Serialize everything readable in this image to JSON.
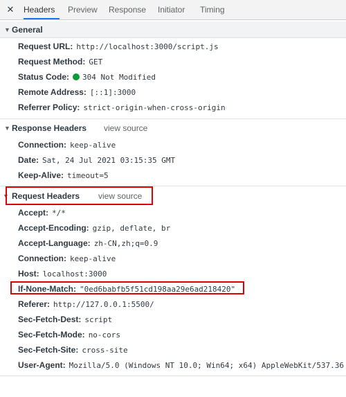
{
  "tabs": {
    "close": "✕",
    "items": [
      "Headers",
      "Preview",
      "Response",
      "Initiator",
      "Timing"
    ]
  },
  "general": {
    "title": "General",
    "request_url": {
      "key": "Request URL:",
      "value": "http://localhost:3000/script.js"
    },
    "request_method": {
      "key": "Request Method:",
      "value": "GET"
    },
    "status_code": {
      "key": "Status Code:",
      "value": "304 Not Modified",
      "status_color": "#0a9a3a"
    },
    "remote_address": {
      "key": "Remote Address:",
      "value": "[::1]:3000"
    },
    "referrer_policy": {
      "key": "Referrer Policy:",
      "value": "strict-origin-when-cross-origin"
    }
  },
  "response_headers": {
    "title": "Response Headers",
    "view_source": "view source",
    "rows": [
      {
        "key": "Connection:",
        "value": "keep-alive"
      },
      {
        "key": "Date:",
        "value": "Sat, 24 Jul 2021 03:15:35 GMT"
      },
      {
        "key": "Keep-Alive:",
        "value": "timeout=5"
      }
    ]
  },
  "request_headers": {
    "title": "Request Headers",
    "view_source": "view source",
    "rows": [
      {
        "key": "Accept:",
        "value": "*/*"
      },
      {
        "key": "Accept-Encoding:",
        "value": "gzip, deflate, br"
      },
      {
        "key": "Accept-Language:",
        "value": "zh-CN,zh;q=0.9"
      },
      {
        "key": "Connection:",
        "value": "keep-alive"
      },
      {
        "key": "Host:",
        "value": "localhost:3000"
      },
      {
        "key": "If-None-Match:",
        "value": "\"0ed6babfb5f51cd198aa29e6ad218420\""
      },
      {
        "key": "Referer:",
        "value": "http://127.0.0.1:5500/"
      },
      {
        "key": "Sec-Fetch-Dest:",
        "value": "script"
      },
      {
        "key": "Sec-Fetch-Mode:",
        "value": "no-cors"
      },
      {
        "key": "Sec-Fetch-Site:",
        "value": "cross-site"
      },
      {
        "key": "User-Agent:",
        "value": "Mozilla/5.0 (Windows NT 10.0; Win64; x64) AppleWebKit/537.36"
      }
    ]
  },
  "colors": {
    "accent": "#1a73e8",
    "highlight_box": "#e00000"
  }
}
